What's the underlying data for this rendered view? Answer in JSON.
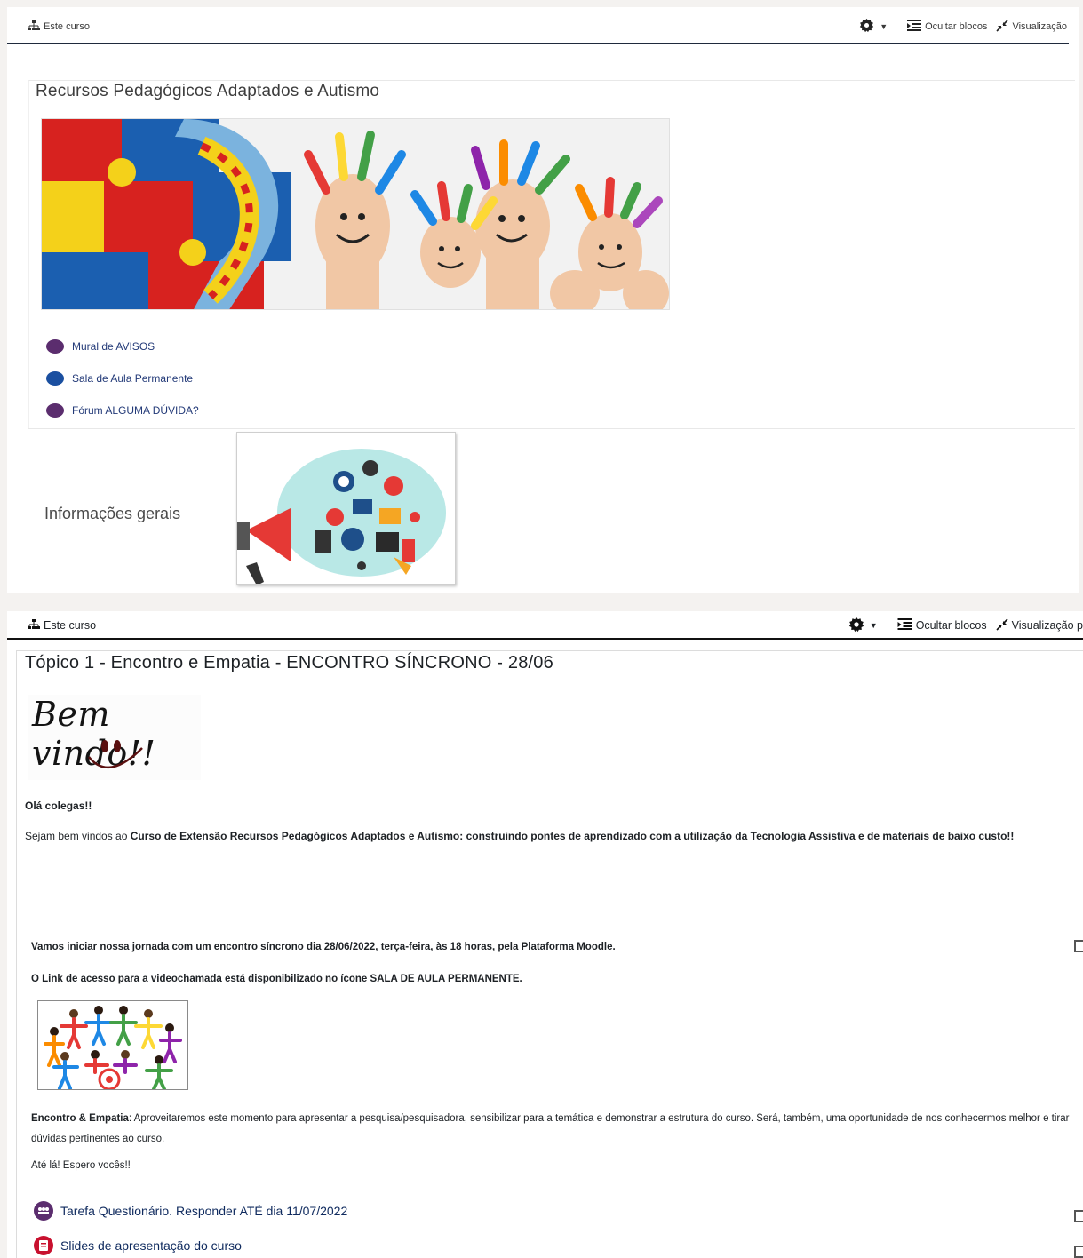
{
  "top": {
    "navbar": {
      "course_nav": "Este curso",
      "hide_blocks": "Ocultar blocos",
      "view": "Visualização"
    },
    "course_title": "Recursos Pedagógicos Adaptados e Autismo",
    "activities": [
      {
        "label": "Mural de AVISOS",
        "icon": "forum-icon",
        "color": "#5b2d6e"
      },
      {
        "label": "Sala de Aula Permanente",
        "icon": "bigbluebutton-icon",
        "color": "#1a4fa0"
      },
      {
        "label": "Fórum ALGUMA DÚVIDA?",
        "icon": "forum-icon",
        "color": "#5b2d6e"
      }
    ],
    "general_section": "Informações gerais"
  },
  "bottom": {
    "navbar": {
      "course_nav": "Este curso",
      "hide_blocks": "Ocultar blocos",
      "view": "Visualização p"
    },
    "topic_title": "Tópico 1 - Encontro e Empatia - ENCONTRO SÍNCRONO - 28/06",
    "welcome_image_text": "Bem vindo!!",
    "greeting": "Olá colegas!!",
    "intro_prefix": "Sejam bem vindos ao ",
    "intro_bold": "Curso de Extensão Recursos Pedagógicos Adaptados e Autismo: construindo pontes de aprendizado com a utilização da Tecnologia Assistiva e de materiais de baixo custo!!",
    "encontro": "Vamos iniciar nossa jornada com um encontro síncrono dia 28/06/2022, terça-feira, às 18 horas, pela Plataforma Moodle.",
    "link_info": "O Link de acesso para a videochamada está disponibilizado no ícone  SALA DE AULA PERMANENTE.",
    "empatia_bold": "Encontro & Empatia",
    "empatia_text": ": Aproveitaremos este momento para apresentar a pesquisa/pesquisadora, sensibilizar para a temática e demonstrar a estrutura do curso. Será, também, uma oportunidade de nos conhecermos melhor e tirar dúvidas pertinentes ao curso.",
    "ate_la": "Até lá! Espero vocês!!",
    "activities": [
      {
        "label": "Tarefa Questionário. Responder ATÉ dia 11/07/2022",
        "icon": "quiz-icon",
        "color": "#5b2d6e"
      },
      {
        "label": "Slides de apresentação do curso",
        "icon": "pdf-icon",
        "color": "#c8102e"
      }
    ]
  }
}
